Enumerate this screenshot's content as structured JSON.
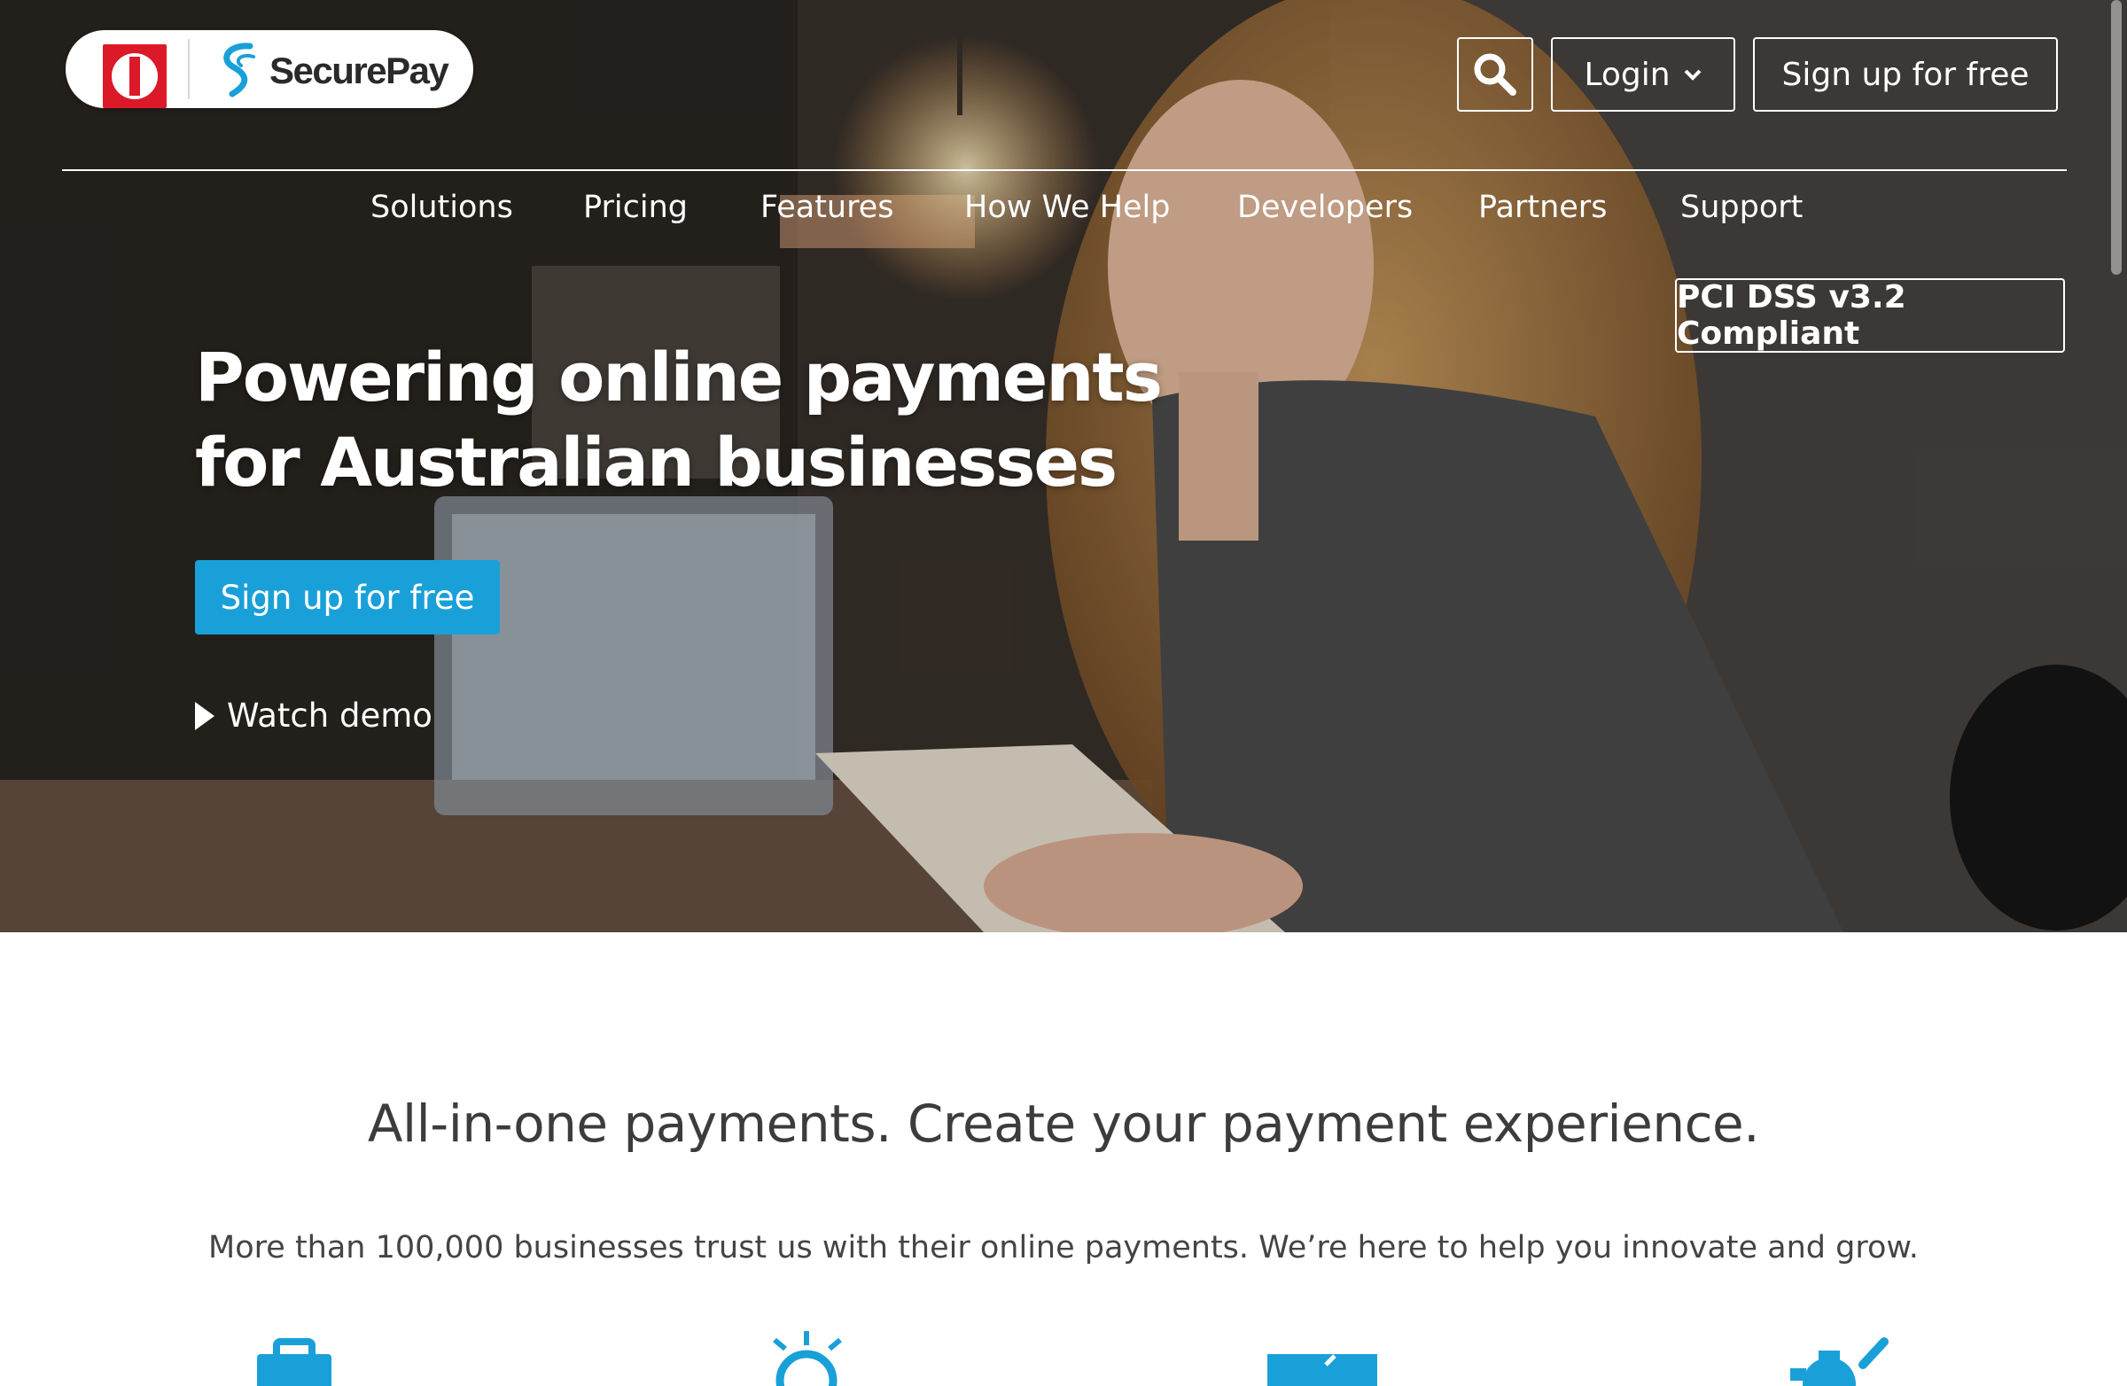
{
  "brand": {
    "name": "SecurePay",
    "colors": {
      "accent": "#1aa0d8",
      "auspost_red": "#dc1928"
    }
  },
  "header": {
    "search_icon": "search-icon",
    "login_label": "Login",
    "login_icon": "chevron-down-icon",
    "signup_label": "Sign up for free"
  },
  "nav": {
    "items": [
      "Solutions",
      "Pricing",
      "Features",
      "How We Help",
      "Developers",
      "Partners",
      "Support"
    ]
  },
  "badge": {
    "label": "PCI DSS v3.2 Compliant"
  },
  "hero": {
    "title_line1": "Powering online payments",
    "title_line2": "for Australian businesses",
    "cta_label": "Sign up for free",
    "demo_label": "Watch demo",
    "demo_icon": "play-icon"
  },
  "intro": {
    "title": "All-in-one payments. Create your payment experience.",
    "subtitle": "More than 100,000 businesses trust us with their online payments. We’re here to help you innovate and grow."
  },
  "features": {
    "icons": [
      "briefcase-icon",
      "lightbulb-icon",
      "document-icon",
      "gear-icon"
    ]
  }
}
